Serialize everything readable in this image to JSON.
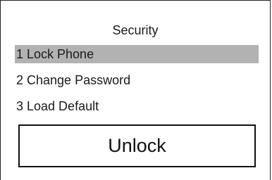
{
  "screen": {
    "title": "Security",
    "selected_index": 0
  },
  "menu": {
    "items": [
      {
        "label": "1 Lock Phone",
        "selected": true
      },
      {
        "label": "2 Change Password",
        "selected": false
      },
      {
        "label": "3 Load Default",
        "selected": false
      }
    ]
  },
  "action": {
    "unlock_label": "Unlock"
  },
  "colors": {
    "selection_highlight": "#b2b2b2",
    "border": "#222222",
    "background": "#ffffff"
  }
}
